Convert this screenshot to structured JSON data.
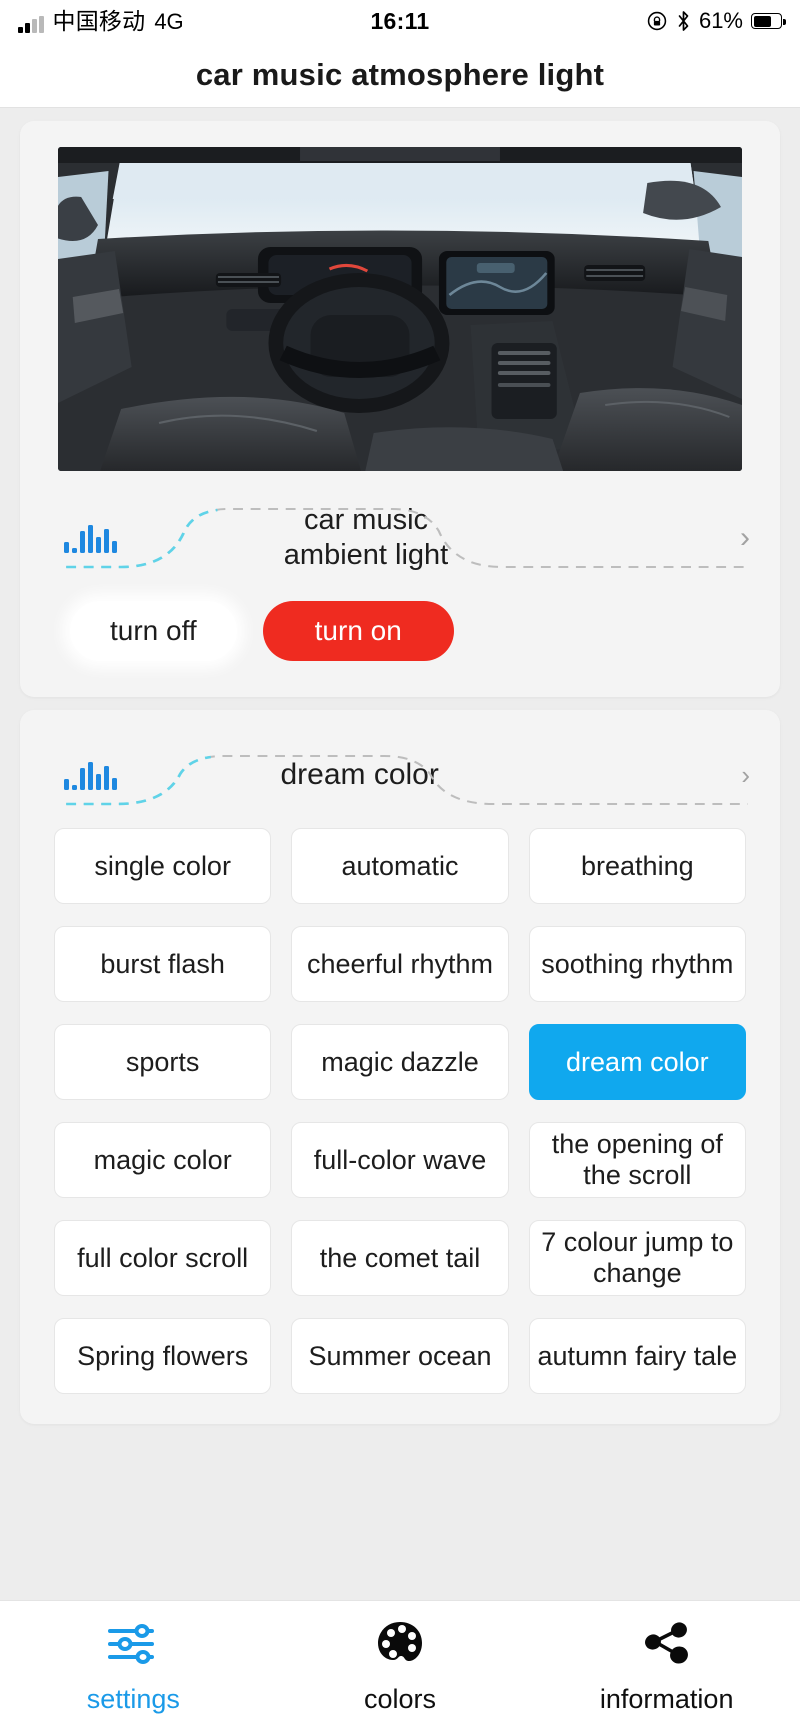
{
  "status_bar": {
    "carrier": "中国移动",
    "network": "4G",
    "time": "16:11",
    "battery_percent": "61%",
    "icons": [
      "signal-bars-icon",
      "rotation-lock-icon",
      "bluetooth-icon",
      "battery-icon"
    ]
  },
  "header": {
    "title": "car music atmosphere light"
  },
  "device_card": {
    "image_alt": "car-interior-photo",
    "device_name": "car music ambient light",
    "device_name_line1": "car music",
    "device_name_line2": "ambient light",
    "chevron": "›",
    "buttons": {
      "turn_off": "turn off",
      "turn_on": "turn on"
    }
  },
  "mode_card": {
    "current_mode": "dream color",
    "chevron": "›",
    "modes": [
      "single color",
      "automatic",
      "breathing",
      "burst flash",
      "cheerful rhythm",
      "soothing rhythm",
      "sports",
      "magic dazzle",
      "dream color",
      "magic color",
      "full-color wave",
      "the opening of the scroll",
      "full color scroll",
      "the comet tail",
      "7 colour jump to change",
      "Spring flowers",
      "Summer ocean",
      "autumn fairy tale"
    ],
    "selected_index": 8
  },
  "tab_bar": {
    "tabs": [
      {
        "label": "settings",
        "icon": "sliders-icon",
        "active": true
      },
      {
        "label": "colors",
        "icon": "palette-icon",
        "active": false
      },
      {
        "label": "information",
        "icon": "share-nodes-icon",
        "active": false
      }
    ]
  },
  "colors": {
    "accent_blue": "#10a8ee",
    "accent_red": "#ef2b20",
    "eq_blue": "#1e88e0",
    "dash_cyan": "#5fd3e8",
    "page_bg": "#ededed",
    "card_bg": "#f4f4f4"
  }
}
